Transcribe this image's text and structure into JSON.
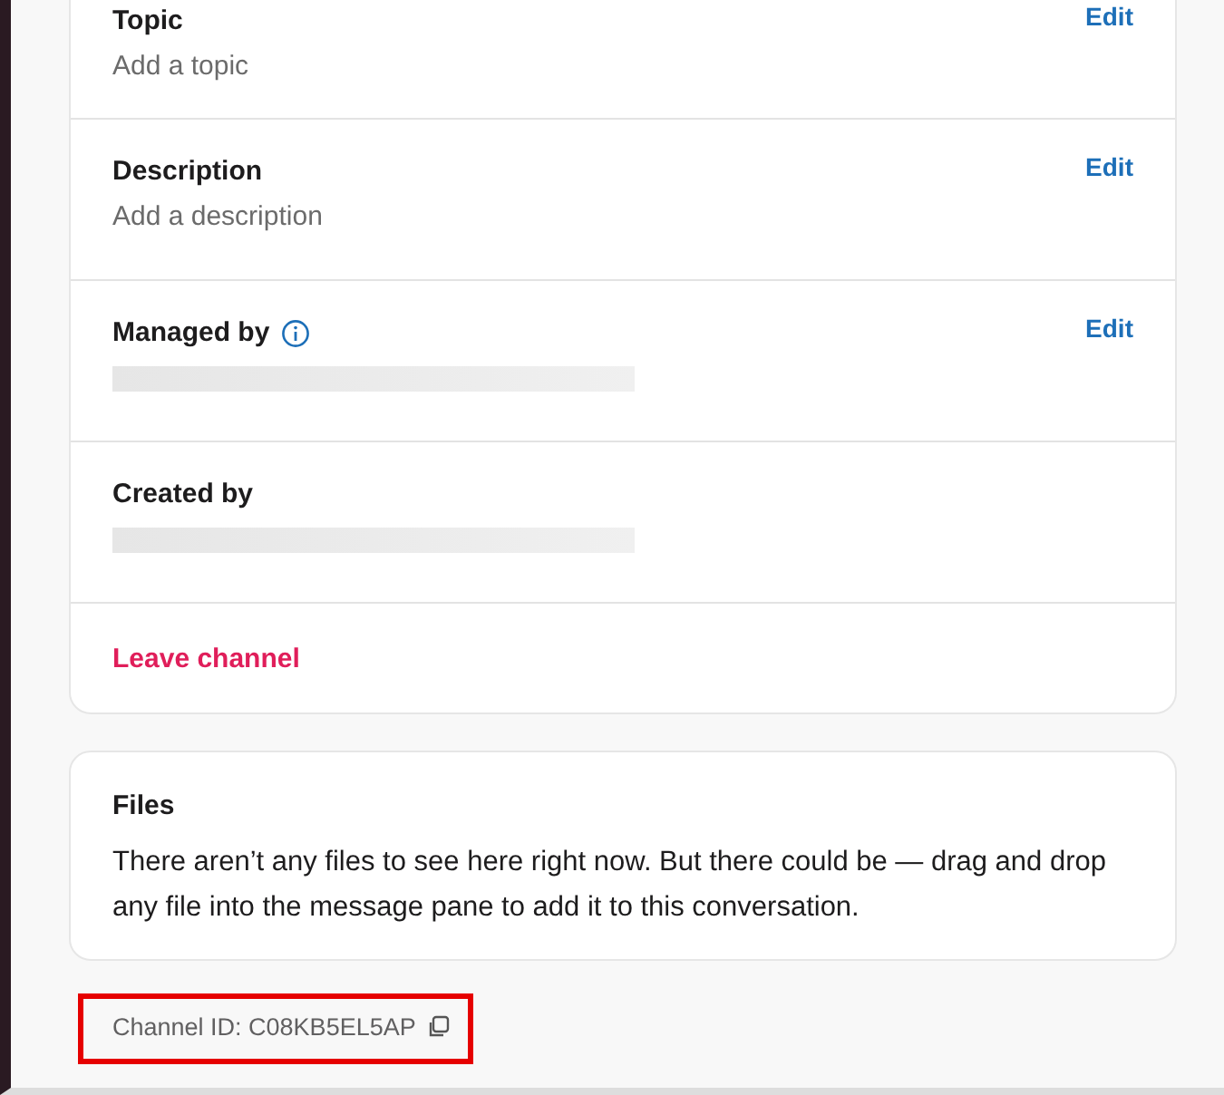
{
  "details": [
    {
      "kind": "field",
      "title": "Topic",
      "value": "Add a topic",
      "value_redacted": false,
      "info": false,
      "action": "Edit"
    },
    {
      "kind": "field",
      "title": "Description",
      "value": "Add a description",
      "value_redacted": false,
      "info": false,
      "action": "Edit"
    },
    {
      "kind": "field",
      "title": "Managed by",
      "value_redacted": true,
      "info": true,
      "action": "Edit"
    },
    {
      "kind": "field",
      "title": "Created by",
      "value_redacted": true,
      "info": false
    },
    {
      "kind": "danger",
      "title": "Leave channel"
    }
  ],
  "files": {
    "title": "Files",
    "text": "There aren’t any files to see here right now. But there could be — drag and drop any file into the message pane to add it to this conversation."
  },
  "channel_id": {
    "text": "Channel ID: C08KB5EL5AP",
    "highlighted": true
  }
}
